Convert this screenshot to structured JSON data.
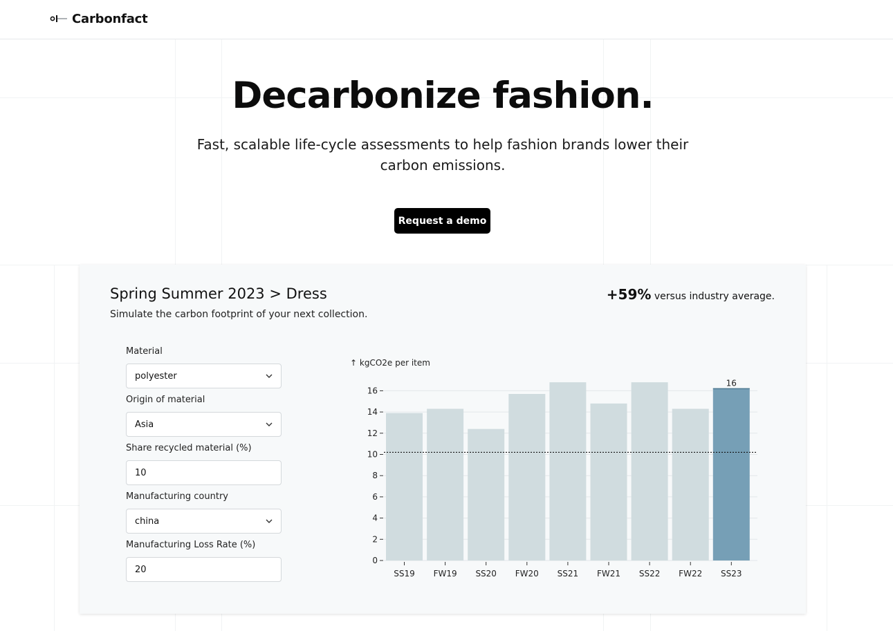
{
  "header": {
    "brand": "Carbonfact"
  },
  "hero": {
    "title": "Decarbonize fashion.",
    "subtitle": "Fast, scalable life-cycle assessments to help fashion brands lower their carbon emissions.",
    "cta": "Request a demo"
  },
  "card": {
    "title": "Spring Summer 2023 > Dress",
    "subtitle": "Simulate the carbon footprint of your next collection.",
    "stat_value": "+59%",
    "stat_label": " versus industry average."
  },
  "form": {
    "material": {
      "label": "Material",
      "value": "polyester"
    },
    "origin": {
      "label": "Origin of material",
      "value": "Asia"
    },
    "recycled": {
      "label": "Share recycled material (%)",
      "value": "10"
    },
    "country": {
      "label": "Manufacturing country",
      "value": "china"
    },
    "loss": {
      "label": "Manufacturing Loss Rate (%)",
      "value": "20"
    }
  },
  "colors": {
    "bar": "#d0dcdf",
    "bar_highlight": "#769fb6",
    "button": "#000000"
  },
  "chart_data": {
    "type": "bar",
    "ylabel": "↑ kgCO2e per item",
    "categories": [
      "SS19",
      "FW19",
      "SS20",
      "FW20",
      "SS21",
      "FW21",
      "SS22",
      "FW22",
      "SS23"
    ],
    "values": [
      13.9,
      14.3,
      12.4,
      15.7,
      16.8,
      14.8,
      16.8,
      14.3,
      16.2
    ],
    "highlight_index": 8,
    "highlight_label": "16",
    "reference_line": 10.2,
    "yticks": [
      0,
      2,
      4,
      6,
      8,
      10,
      12,
      14,
      16
    ],
    "ylim": [
      0,
      17
    ],
    "grid": true
  }
}
